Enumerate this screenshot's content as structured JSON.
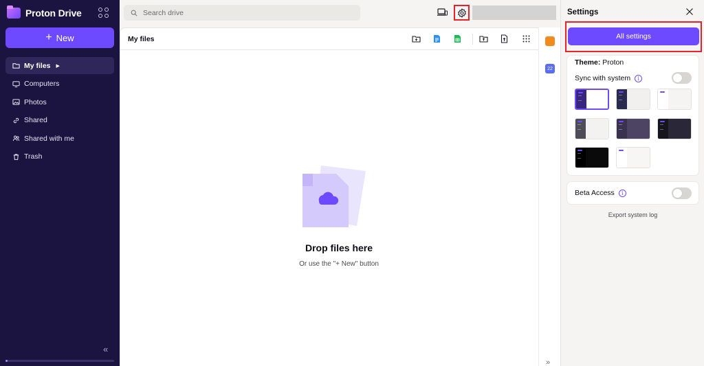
{
  "app": {
    "name": "Proton Drive"
  },
  "sidebar": {
    "new_label": "New",
    "items": [
      {
        "label": "My files",
        "icon": "folder-icon",
        "active": true
      },
      {
        "label": "Computers",
        "icon": "monitor-icon"
      },
      {
        "label": "Photos",
        "icon": "image-icon"
      },
      {
        "label": "Shared",
        "icon": "link-icon"
      },
      {
        "label": "Shared with me",
        "icon": "users-icon"
      },
      {
        "label": "Trash",
        "icon": "trash-icon"
      }
    ],
    "storage_used_fraction": 0.02
  },
  "search": {
    "placeholder": "Search drive"
  },
  "main": {
    "title": "My files",
    "empty_title": "Drop files here",
    "empty_subtitle": "Or use the \"+ New\" button"
  },
  "settings": {
    "title": "Settings",
    "all_settings_label": "All settings",
    "theme_label": "Theme:",
    "theme_value": "Proton",
    "sync_label": "Sync with system",
    "sync_on": false,
    "themes": [
      {
        "side": "#372580",
        "main": "#ffffff",
        "selected": true
      },
      {
        "side": "#2a2a4f",
        "main": "#f1f0ee"
      },
      {
        "side": "#ffffff",
        "main": "#f5f4f2"
      },
      {
        "side": "#4e4d57",
        "main": "#f3f2f0"
      },
      {
        "side": "#3a3350",
        "main": "#4c4462"
      },
      {
        "side": "#16141c",
        "main": "#2a2838"
      },
      {
        "side": "#000000",
        "main": "#0a0a0a"
      },
      {
        "side": "#ffffff",
        "main": "#f7f6f4"
      }
    ],
    "beta_label": "Beta Access",
    "beta_on": false,
    "export_log_label": "Export system log"
  },
  "colors": {
    "accent": "#6d4aff",
    "sidebar_bg": "#1b1340",
    "highlight": "#e8222b"
  }
}
